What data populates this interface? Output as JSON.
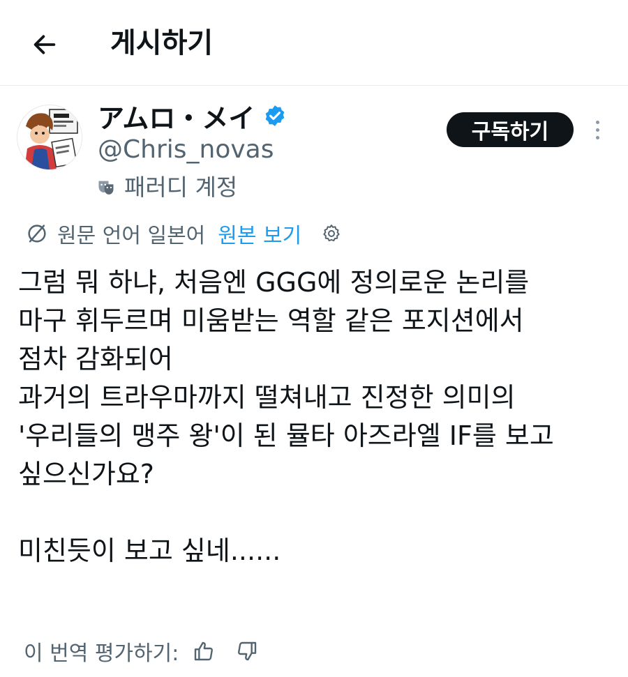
{
  "header": {
    "title": "게시하기",
    "back_icon": "arrow-left-icon"
  },
  "author": {
    "display_name": "アムロ・メイ",
    "verified": true,
    "verified_color": "#1d9bf0",
    "handle": "@Chris_novas",
    "parody_label": "패러디 계정",
    "parody_icon": "theater-mask-icon"
  },
  "actions": {
    "subscribe_label": "구독하기",
    "more_icon": "more-vertical-icon"
  },
  "translation": {
    "source_label": "원문 언어 일본어",
    "show_original_label": "원본 보기",
    "link_color": "#1d9bf0"
  },
  "tweet": {
    "lines": [
      "그럼 뭐 하냐, 처음엔 GGG에 정의로운 논리를",
      "마구 휘두르며 미움받는 역할 같은 포지션에서",
      "점차 감화되어",
      "과거의 트라우마까지 떨쳐내고 진정한 의미의",
      "'우리들의 맹주 왕'이 된 뮬타 아즈라엘 IF를 보고",
      "싶으신가요?",
      "",
      "미친듯이 보고 싶네......"
    ]
  },
  "rating": {
    "label": "이 번역 평가하기:",
    "up_icon": "thumbs-up-icon",
    "down_icon": "thumbs-down-icon"
  }
}
